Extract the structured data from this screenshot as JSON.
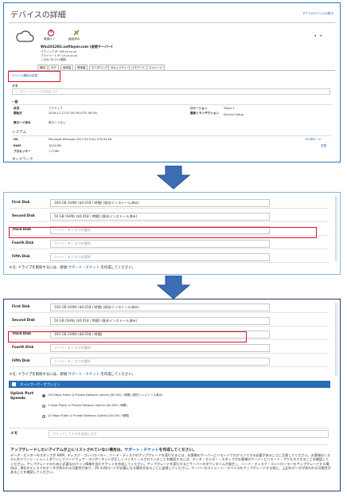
{
  "panel1": {
    "title": "デバイスの詳細",
    "view_all_link": "すべてのデバイスの表示",
    "power_status": "電源オン",
    "connection_status": "接続済み",
    "device_name": "Win2012R2.softlayer.com (仮想サーバー)",
    "public_ip": "パブリック IP: 169.xx.xx.xx",
    "private_ip": "プライベート IP: 10.xx.xx.xx",
    "current_cost": "この月: $0.21 (概算)",
    "nav_prev": "◂",
    "nav_next": "▸",
    "tabs": [
      "構成",
      "タグ",
      "使用量",
      "帯域幅",
      "モニタリング",
      "セキュリティー",
      "パスワード",
      "ストレージ"
    ],
    "edit_details_link": "デバイス構成の変更",
    "notes_label": "メモ",
    "notes_placeholder": "ここをクリックしてメモを追加します",
    "general_heading": "一般",
    "status_label": "状況",
    "status_value": "アクティブ",
    "started_label": "開始日",
    "started_value": "2016-11-22 02:34 PM (UTC-06:00)",
    "location_label": "ロケーション",
    "location_value": "Tokyo 2",
    "transaction_label": "最新トランザクション",
    "transaction_value": "Service Setup",
    "reload_label": "再ロード済み",
    "reload_value": "再ロードなし",
    "system_heading": "システム",
    "os_label": "OS",
    "os_value": "Microsoft Windows 2012 R2 FULL STD 64 bit",
    "os_link": "OS 再ロード",
    "ram_label": "RAM",
    "ram_value": "1024 MB",
    "ram_link": "変更",
    "cpu_label": "プロセッサー",
    "cpu_value": "1 CORE",
    "network_heading": "ネットワーク"
  },
  "disks_panel2": [
    {
      "label": "First Disk",
      "value": "100 GB (SAN) ($0.018 / 時間) (既存インストール済み)",
      "placeholder": false
    },
    {
      "label": "Second Disk",
      "value": "50 GB (SAN) ($0.018 / 時間) (既存インストール済み)",
      "placeholder": false
    },
    {
      "label": "Third Disk",
      "value": "ハード・ディスクの選択",
      "placeholder": true
    },
    {
      "label": "Fourth Disk",
      "value": "ハード・ディスクの選択",
      "placeholder": true
    },
    {
      "label": "Fifth Disk",
      "value": "ハード・ディスクの選択",
      "placeholder": true
    }
  ],
  "panel2_note_prefix": "メモ: ドライブを削除するには、新規 ",
  "panel2_note_link": "サポート・チケット",
  "panel2_note_suffix": " を作成してください。",
  "disks_panel3": [
    {
      "label": "First Disk",
      "value": "100 GB (SAN) ($0.018 / 時間) (既存インストール済み)",
      "placeholder": false
    },
    {
      "label": "Second Disk",
      "value": "50 GB (SAN) ($0.018 / 時間) (既存インストール済み)",
      "placeholder": false
    },
    {
      "label": "Third Disk",
      "value": "100 GB (SAN) ($0.018 / 時間)",
      "placeholder": false
    },
    {
      "label": "Fourth Disk",
      "value": "ハード・ディスクの選択",
      "placeholder": true
    },
    {
      "label": "Fifth Disk",
      "value": "ハード・ディスクの選択",
      "placeholder": true
    }
  ],
  "panel3": {
    "note_prefix": "メモ: ドライブを削除するには、新規 ",
    "note_link": "サポート・チケット",
    "note_suffix": " を作成してください。",
    "network_option_header": "ネットワーク・オプション",
    "uplink_label": "Uplink Port Speeds",
    "uplink_options": [
      "100 Mbps Public & Private Network Uplinks [$0.000 / 時間] (現在インストール済み)",
      "1 Gbps Public & Private Network Uplinks [$0.043 / 時間]",
      "10 Mbps Public & Private Network Uplinks [$0.000 / 時間]"
    ],
    "notes_label": "メモ",
    "notes_placeholder": "クリックしてメモを追加します",
    "upgrade_prefix": "アップグレードしたいアイテムが上にリストされていない場合は、",
    "upgrade_link": "サポート・チケット",
    "upgrade_suffix": "を作成してください。",
    "disclaimer": "データ・センターのスタッフが RAM、ディスク・コントローラー、ハード・ディスクのアップグレードを実行するには、お客様のサーバーにリモートでログインできる必要があることに注意してください。お客様のシステムをクリーン・シャットダウンしてハードウェア・コンポーネントが正しくインストールされていることを確認するには、データ・センター・スタッフがお客様のサーバーにリモート・アクセスできることを確認してください。アップグレードのために必要なログイン情報を含むチケットを作成してください。アップグレードを実行するとサーバーのダウンタイムが発生し、ハード・ディスク・コントローラーをアップグレードする場合は、現在のディスクのデータが失われる可能性があり、OS の再ロードが必要になる場合があることに留意してください。サーバーのストレージ・デバイスをアップグレードする前に、上記のデータが失われる可能性があることを確認してください。"
  },
  "colors": {
    "highlight": "#e0102a",
    "arrow": "#3d6db5",
    "link": "#1a5fb4",
    "section_header": "#2a6db7"
  }
}
